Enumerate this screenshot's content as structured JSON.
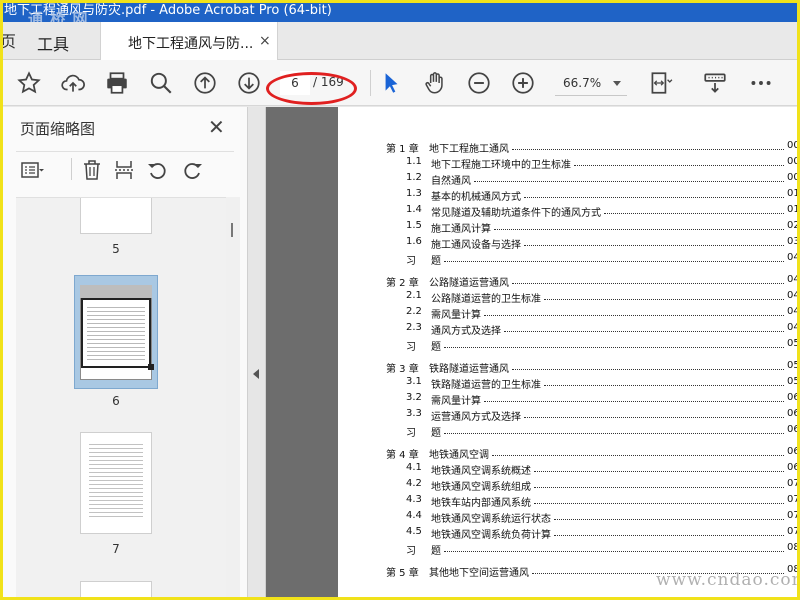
{
  "window": {
    "title": "地下工程通风与防灾.pdf - Adobe Acrobat Pro (64-bit)",
    "watermark_top": "通 桥 网"
  },
  "tabs": {
    "home_label": "页",
    "tools_label": "工具",
    "doc_label": "地下工程通风与防...",
    "close_glyph": "×"
  },
  "toolbar": {
    "current_page": "6",
    "total_pages": "/ 169",
    "zoom": "66.7%"
  },
  "left_panel": {
    "title": "页面缩略图",
    "close_glyph": "✕",
    "thumbnails": [
      {
        "label": "5"
      },
      {
        "label": "6"
      },
      {
        "label": "7"
      }
    ]
  },
  "toc": [
    {
      "num": "第 1 章",
      "title": "地下工程施工通风",
      "page": "00",
      "level": 0
    },
    {
      "num": "1.1",
      "title": "地下工程施工环境中的卫生标准",
      "page": "00",
      "level": 1
    },
    {
      "num": "1.2",
      "title": "自然通风",
      "page": "00",
      "level": 1
    },
    {
      "num": "1.3",
      "title": "基本的机械通风方式",
      "page": "01",
      "level": 1
    },
    {
      "num": "1.4",
      "title": "常见隧道及辅助坑道条件下的通风方式",
      "page": "01",
      "level": 1
    },
    {
      "num": "1.5",
      "title": "施工通风计算",
      "page": "02",
      "level": 1
    },
    {
      "num": "1.6",
      "title": "施工通风设备与选择",
      "page": "03",
      "level": 1
    },
    {
      "num": "习",
      "title": "题",
      "page": "04",
      "level": 1
    },
    {
      "num": "第 2 章",
      "title": "公路隧道运营通风",
      "page": "04",
      "level": 0
    },
    {
      "num": "2.1",
      "title": "公路隧道运营的卫生标准",
      "page": "04",
      "level": 1
    },
    {
      "num": "2.2",
      "title": "需风量计算",
      "page": "04",
      "level": 1
    },
    {
      "num": "2.3",
      "title": "通风方式及选择",
      "page": "04",
      "level": 1
    },
    {
      "num": "习",
      "title": "题",
      "page": "05",
      "level": 1
    },
    {
      "num": "第 3 章",
      "title": "铁路隧道运营通风",
      "page": "05",
      "level": 0
    },
    {
      "num": "3.1",
      "title": "铁路隧道运营的卫生标准",
      "page": "05",
      "level": 1
    },
    {
      "num": "3.2",
      "title": "需风量计算",
      "page": "06",
      "level": 1
    },
    {
      "num": "3.3",
      "title": "运营通风方式及选择",
      "page": "06",
      "level": 1
    },
    {
      "num": "习",
      "title": "题",
      "page": "06",
      "level": 1
    },
    {
      "num": "第 4 章",
      "title": "地铁通风空调",
      "page": "06",
      "level": 0
    },
    {
      "num": "4.1",
      "title": "地铁通风空调系统概述",
      "page": "06",
      "level": 1
    },
    {
      "num": "4.2",
      "title": "地铁通风空调系统组成",
      "page": "07",
      "level": 1
    },
    {
      "num": "4.3",
      "title": "地铁车站内部通风系统",
      "page": "07",
      "level": 1
    },
    {
      "num": "4.4",
      "title": "地铁通风空调系统运行状态",
      "page": "07",
      "level": 1
    },
    {
      "num": "4.5",
      "title": "地铁通风空调系统负荷计算",
      "page": "07",
      "level": 1
    },
    {
      "num": "习",
      "title": "题",
      "page": "08",
      "level": 1
    },
    {
      "num": "第 5 章",
      "title": "其他地下空间运营通风",
      "page": "08",
      "level": 0
    }
  ],
  "watermark_bottom": "www.cndao.com"
}
